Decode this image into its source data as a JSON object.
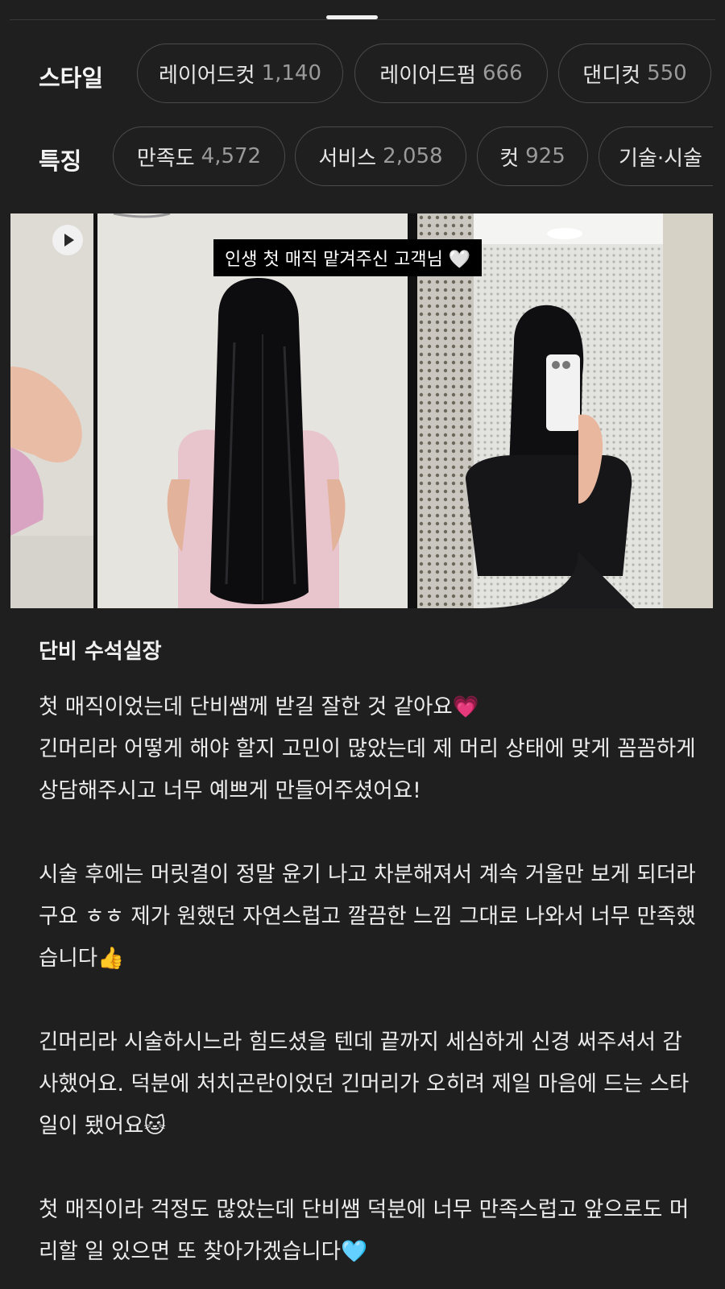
{
  "filters": {
    "style_label": "스타일",
    "style_chips": [
      {
        "name": "레이어드컷",
        "count": "1,140"
      },
      {
        "name": "레이어드펌",
        "count": "666"
      },
      {
        "name": "댄디컷",
        "count": "550"
      }
    ],
    "feature_label": "특징",
    "feature_chips": [
      {
        "name": "만족도",
        "count": "4,572"
      },
      {
        "name": "서비스",
        "count": "2,058"
      },
      {
        "name": "컷",
        "count": "925"
      },
      {
        "name": "기술·시술",
        "count": ""
      }
    ]
  },
  "media": {
    "caption": "인생 첫 매직 맡겨주신 고객님 🤍",
    "play_icon": "play-icon"
  },
  "review": {
    "author": "단비 수석실장",
    "paragraphs": [
      "첫 매직이었는데 단비쌤께 받길 잘한 것 같아요💗\n긴머리라 어떻게 해야 할지 고민이 많았는데 제 머리 상태에 맞게 꼼꼼하게 상담해주시고 너무 예쁘게 만들어주셨어요!",
      "시술 후에는 머릿결이 정말 윤기 나고 차분해져서 계속 거울만 보게 되더라구요 ㅎㅎ 제가 원했던 자연스럽고 깔끔한 느낌 그대로 나와서 너무 만족했습니다👍",
      "긴머리라 시술하시느라 힘드셨을 텐데 끝까지 세심하게 신경 써주셔서 감사했어요. 덕분에 처치곤란이었던 긴머리가 오히려 제일 마음에 드는 스타일이 됐어요🐱",
      "첫 매직이라 걱정도 많았는데 단비쌤 덕분에 너무 만족스럽고 앞으로도 머리할 일 있으면 또 찾아가겠습니다🩵"
    ]
  }
}
